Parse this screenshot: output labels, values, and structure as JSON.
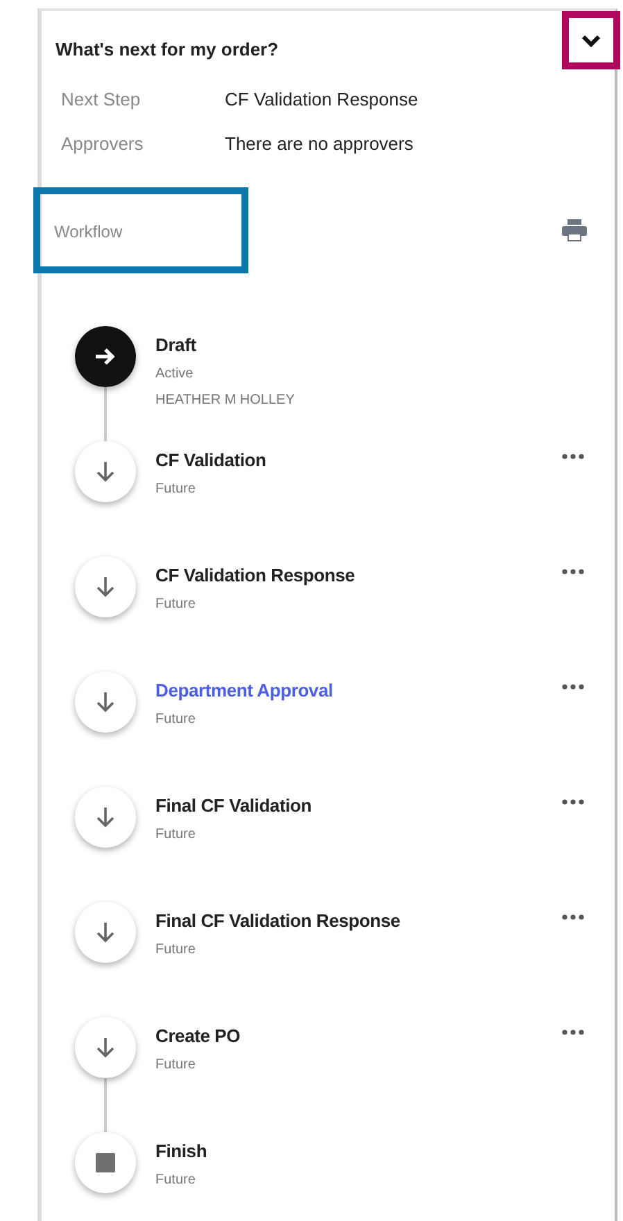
{
  "summary": {
    "title": "What's next for my order?",
    "expanded": true,
    "toggle_highlighted": true,
    "fields": [
      {
        "label": "Next Step",
        "value": "CF Validation Response"
      },
      {
        "label": "Approvers",
        "value": "There are no approvers"
      }
    ]
  },
  "workflow": {
    "label": "Workflow",
    "label_highlighted": true,
    "steps": [
      {
        "kind": "active",
        "title": "Draft",
        "status": "Active",
        "assignee": "HEATHER M HOLLEY",
        "link": false,
        "has_menu": false,
        "connector_below": true
      },
      {
        "kind": "future",
        "title": "CF Validation",
        "status": "Future",
        "link": false,
        "has_menu": true,
        "connector_below": false
      },
      {
        "kind": "future",
        "title": "CF Validation Response",
        "status": "Future",
        "link": false,
        "has_menu": true,
        "connector_below": false
      },
      {
        "kind": "future",
        "title": "Department Approval",
        "status": "Future",
        "link": true,
        "has_menu": true,
        "connector_below": false
      },
      {
        "kind": "future",
        "title": "Final CF Validation",
        "status": "Future",
        "link": false,
        "has_menu": true,
        "connector_below": false
      },
      {
        "kind": "future",
        "title": "Final CF Validation Response",
        "status": "Future",
        "link": false,
        "has_menu": true,
        "connector_below": false
      },
      {
        "kind": "future",
        "title": "Create PO",
        "status": "Future",
        "link": false,
        "has_menu": true,
        "connector_below": true
      },
      {
        "kind": "finish",
        "title": "Finish",
        "status": "Future",
        "link": false,
        "has_menu": false,
        "connector_below": false
      }
    ]
  }
}
